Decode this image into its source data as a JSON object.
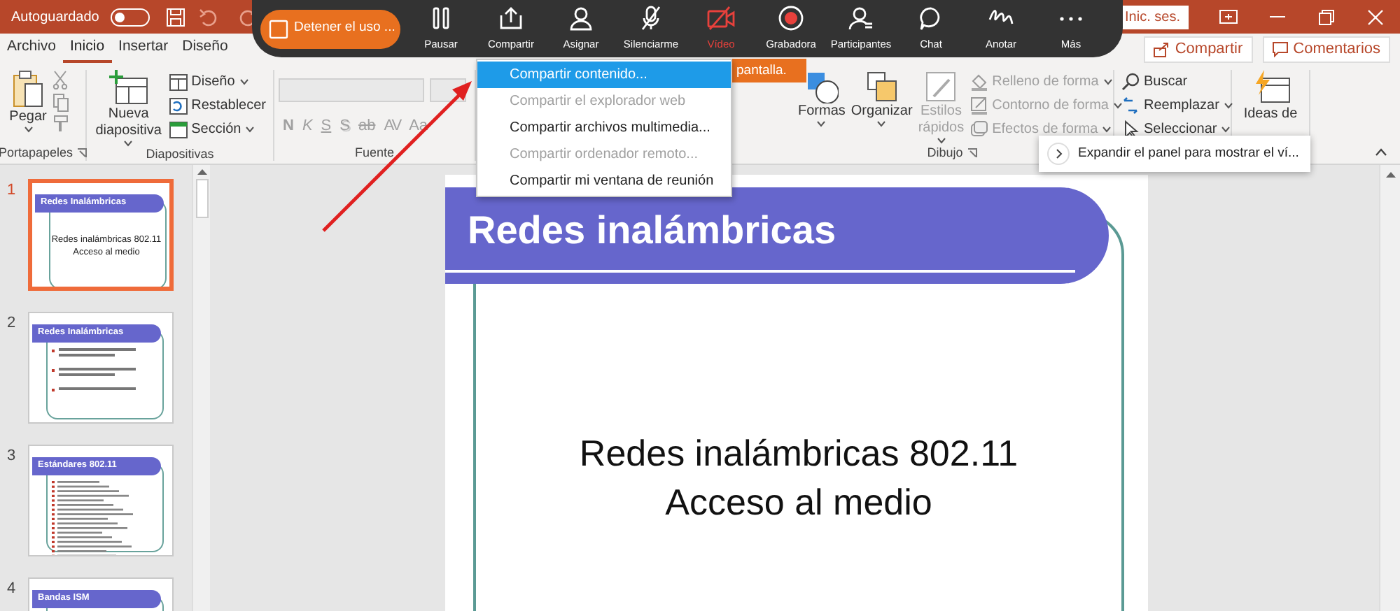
{
  "title_bar": {
    "autosave_label": "Autoguardado",
    "autosave_on": false,
    "sign_in_button": "Inic. ses."
  },
  "meeting_toolbar": {
    "stop_button": "Detener el uso ...",
    "items": [
      {
        "kind": "pause",
        "label": "Pausar",
        "color": "#ffffff"
      },
      {
        "kind": "share",
        "label": "Compartir",
        "color": "#ffffff"
      },
      {
        "kind": "assign",
        "label": "Asignar",
        "color": "#ffffff"
      },
      {
        "kind": "mute",
        "label": "Silenciarme",
        "color": "#ffffff"
      },
      {
        "kind": "video",
        "label": "Vídeo",
        "color": "#e8413c"
      },
      {
        "kind": "record",
        "label": "Grabadora",
        "color": "#ffffff"
      },
      {
        "kind": "participants",
        "label": "Participantes",
        "color": "#ffffff"
      },
      {
        "kind": "chat",
        "label": "Chat",
        "color": "#ffffff"
      },
      {
        "kind": "annotate",
        "label": "Anotar",
        "color": "#ffffff"
      },
      {
        "kind": "more",
        "label": "Más",
        "color": "#ffffff"
      }
    ],
    "notice": "pantalla."
  },
  "share_menu": [
    {
      "label": "Compartir contenido...",
      "selected": true,
      "disabled": false
    },
    {
      "label": "Compartir el explorador web",
      "selected": false,
      "disabled": true
    },
    {
      "label": "Compartir archivos multimedia...",
      "selected": false,
      "disabled": false
    },
    {
      "label": "Compartir ordenador remoto...",
      "selected": false,
      "disabled": true
    },
    {
      "label": "Compartir mi ventana de reunión",
      "selected": false,
      "disabled": false
    }
  ],
  "tabs": [
    {
      "label": "Archivo",
      "selected": false
    },
    {
      "label": "Inicio",
      "selected": true
    },
    {
      "label": "Insertar",
      "selected": false
    },
    {
      "label": "Diseño",
      "selected": false
    }
  ],
  "share_button": "Compartir",
  "comments_button": "Comentarios",
  "ribbon": {
    "clipboard": {
      "label": "Portapapeles",
      "paste": "Pegar"
    },
    "slides": {
      "label": "Diapositivas",
      "new_slide": "Nueva diapositiva",
      "commands": [
        "Diseño",
        "Restablecer",
        "Sección"
      ]
    },
    "font": {
      "label": "Fuente",
      "disabled": true,
      "format_buttons": [
        "N",
        "K",
        "S",
        "S",
        "ab",
        "AV",
        "Aa"
      ]
    },
    "drawing": {
      "label": "Dibujo",
      "large": [
        {
          "label": "Formas",
          "disabled": false
        },
        {
          "label": "Organizar",
          "disabled": false
        },
        {
          "label": "Estilos rápidos",
          "disabled": true
        }
      ],
      "small": [
        {
          "label": "Relleno de forma",
          "disabled": true
        },
        {
          "label": "Contorno de forma",
          "disabled": true
        },
        {
          "label": "Efectos de forma",
          "disabled": true
        }
      ]
    },
    "editing": {
      "commands": [
        "Buscar",
        "Reemplazar",
        "Seleccionar"
      ]
    },
    "designer": {
      "label": "Ideas de"
    }
  },
  "expand_tooltip": "Expandir el panel para mostrar el ví...",
  "slides": [
    {
      "number": "1",
      "kind": "title",
      "title": "Redes Inalámbricas",
      "lines": [
        "Redes inalámbricas 802.11",
        "Acceso al medio"
      ],
      "selected": true
    },
    {
      "number": "2",
      "kind": "bullets",
      "title": "Redes Inalámbricas",
      "selected": false
    },
    {
      "number": "3",
      "kind": "list",
      "title": "Estándares 802.11",
      "selected": false
    },
    {
      "number": "4",
      "kind": "heading",
      "title": "Bandas ISM",
      "selected": false
    }
  ],
  "current_slide": {
    "title": "Redes inalámbricas",
    "lines": [
      "Redes inalámbricas 802.11",
      "Acceso al medio"
    ]
  }
}
